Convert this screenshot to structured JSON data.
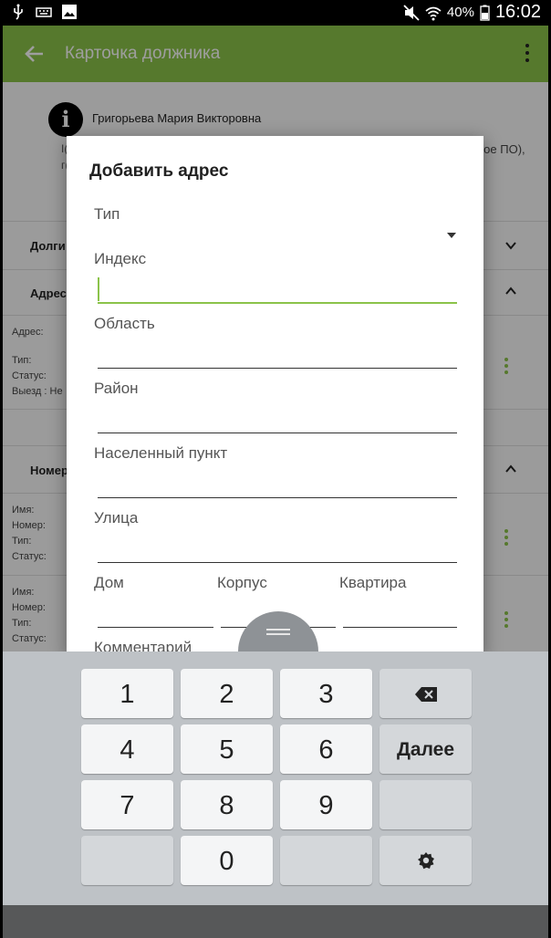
{
  "status_bar": {
    "battery": "40%",
    "time": "16:02"
  },
  "app_bar": {
    "title": "Карточка должника"
  },
  "background": {
    "person_name": "Григорьева Мария Викторовна",
    "person_extra": "ное ПО),",
    "sections": [
      {
        "title": "Долги"
      },
      {
        "title": "Адрес"
      },
      {
        "title": "Номер"
      }
    ],
    "address_fields": {
      "address": "Адрес:",
      "type": "Тип:",
      "status": "Статус:",
      "visit": "Выезд : Не"
    },
    "phone_fields_1": {
      "name": "Имя:",
      "number": "Номер:",
      "type": "Тип:",
      "status": "Статус:"
    },
    "phone_fields_2": {
      "name": "Имя:",
      "number": "Номер:",
      "type": "Тип:",
      "status": "Статус:"
    }
  },
  "dialog": {
    "title": "Добавить адрес",
    "fields": {
      "type": {
        "label": "Тип",
        "value": ""
      },
      "index": {
        "label": "Индекс",
        "value": ""
      },
      "region": {
        "label": "Область",
        "value": ""
      },
      "district": {
        "label": "Район",
        "value": ""
      },
      "locality": {
        "label": "Населенный пункт",
        "value": ""
      },
      "street": {
        "label": "Улица",
        "value": ""
      },
      "house": {
        "label": "Дом",
        "value": ""
      },
      "building": {
        "label": "Корпус",
        "value": ""
      },
      "apartment": {
        "label": "Квартира",
        "value": ""
      },
      "comment": {
        "label": "Комментарий",
        "value": ""
      }
    }
  },
  "keyboard": {
    "keys": [
      "1",
      "2",
      "3",
      "4",
      "5",
      "6",
      "7",
      "8",
      "9",
      "0"
    ],
    "next_label": "Далее",
    "backspace_icon": "backspace-icon",
    "settings_icon": "gear-icon"
  },
  "colors": {
    "accent": "#8bc34a",
    "keyboard_bg": "#bec2c6"
  }
}
